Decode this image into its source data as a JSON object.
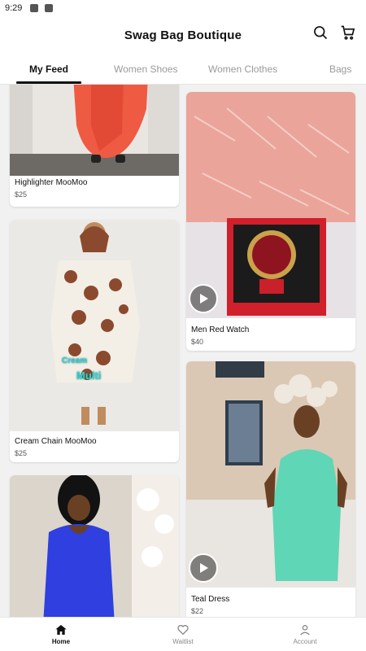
{
  "status": {
    "time": "9:29"
  },
  "header": {
    "title": "Swag Bag Boutique",
    "search_icon": "search-icon",
    "cart_icon": "cart-icon"
  },
  "tabs": [
    {
      "label": "My Feed",
      "active": true
    },
    {
      "label": "Women Shoes",
      "active": false
    },
    {
      "label": "Women Clothes",
      "active": false
    },
    {
      "label": "Bags",
      "active": false
    }
  ],
  "products": [
    {
      "name": "Highlighter MooMoo",
      "price": "$25",
      "video": false
    },
    {
      "name": "Men Red Watch",
      "price": "$40",
      "video": true
    },
    {
      "name": "Cream Chain MooMoo",
      "price": "$25",
      "video": false,
      "overlay": [
        "Cream",
        "Multi"
      ]
    },
    {
      "name": "Teal Dress",
      "price": "$22",
      "video": true
    },
    {
      "name": "",
      "price": "",
      "video": false
    }
  ],
  "nav": [
    {
      "label": "Home",
      "icon": "home-icon",
      "active": true
    },
    {
      "label": "Waitlist",
      "icon": "heart-icon",
      "active": false
    },
    {
      "label": "Account",
      "icon": "person-icon",
      "active": false
    }
  ],
  "colors": {
    "accent": "#111111",
    "background": "#f1f1f1",
    "inactive_tab": "#9a9a9a"
  }
}
